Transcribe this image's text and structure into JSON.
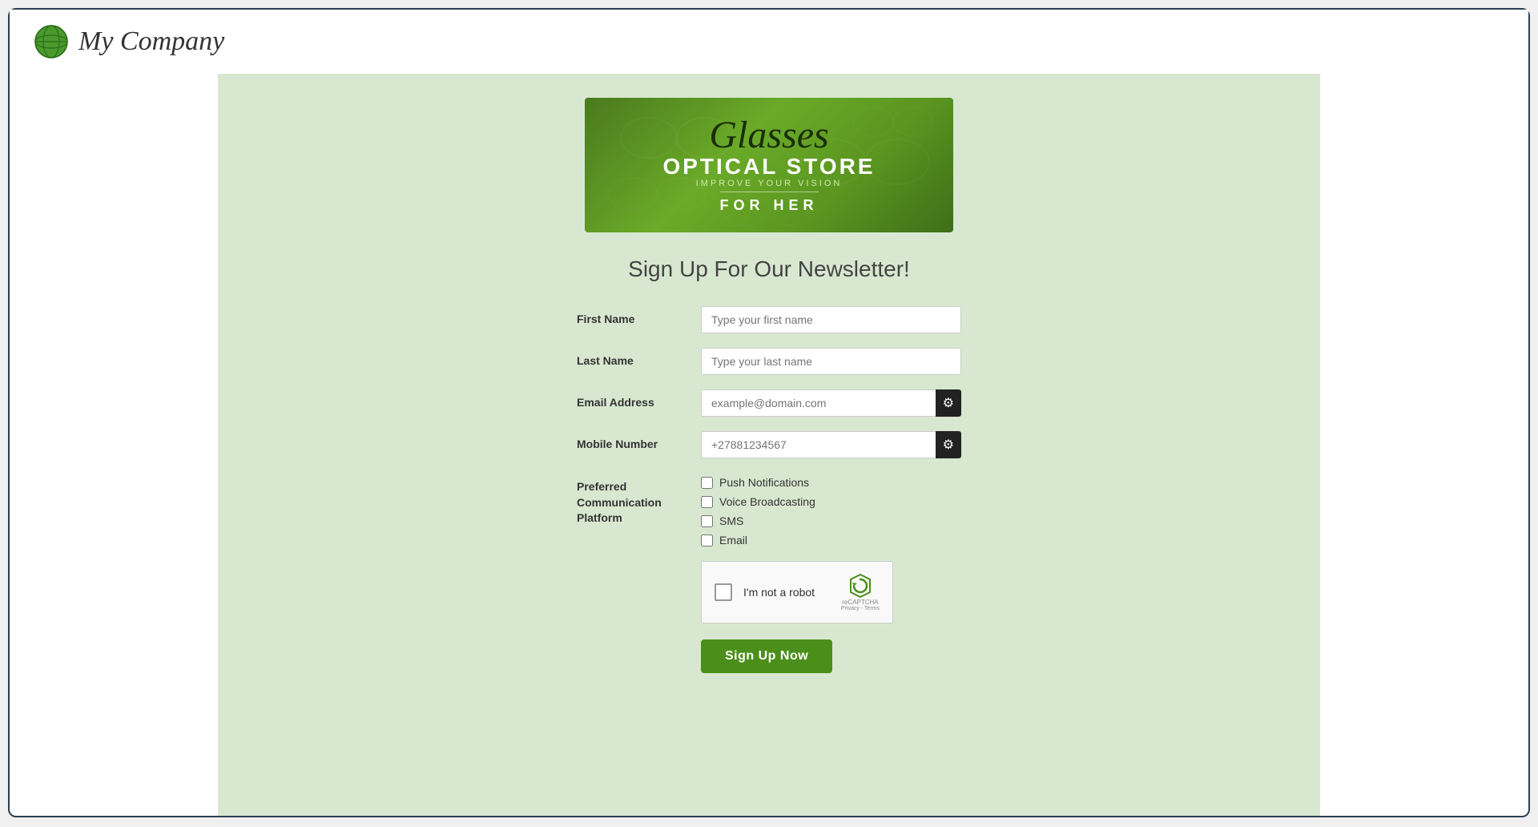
{
  "header": {
    "company_name": "My Company",
    "globe_icon": "globe-icon"
  },
  "banner": {
    "text_glasses": "Glasses",
    "text_optical": "OPTICAL STORE",
    "text_improve": "IMPROVE YOUR VISION",
    "text_forher": "FOR HER"
  },
  "form": {
    "heading": "Sign Up For Our Newsletter!",
    "first_name_label": "First Name",
    "first_name_placeholder": "Type your first name",
    "last_name_label": "Last Name",
    "last_name_placeholder": "Type your last name",
    "email_label": "Email Address",
    "email_placeholder": "example@domain.com",
    "mobile_label": "Mobile Number",
    "mobile_placeholder": "+27881234567",
    "preferred_label_line1": "Preferred",
    "preferred_label_line2": "Communication",
    "preferred_label_line3": "Platform",
    "checkbox_push": "Push Notifications",
    "checkbox_voice": "Voice Broadcasting",
    "checkbox_sms": "SMS",
    "checkbox_email": "Email",
    "recaptcha_label": "I'm not a robot",
    "recaptcha_brand": "reCAPTCHA",
    "recaptcha_privacy": "Privacy - Terms",
    "signup_btn": "Sign Up Now"
  }
}
